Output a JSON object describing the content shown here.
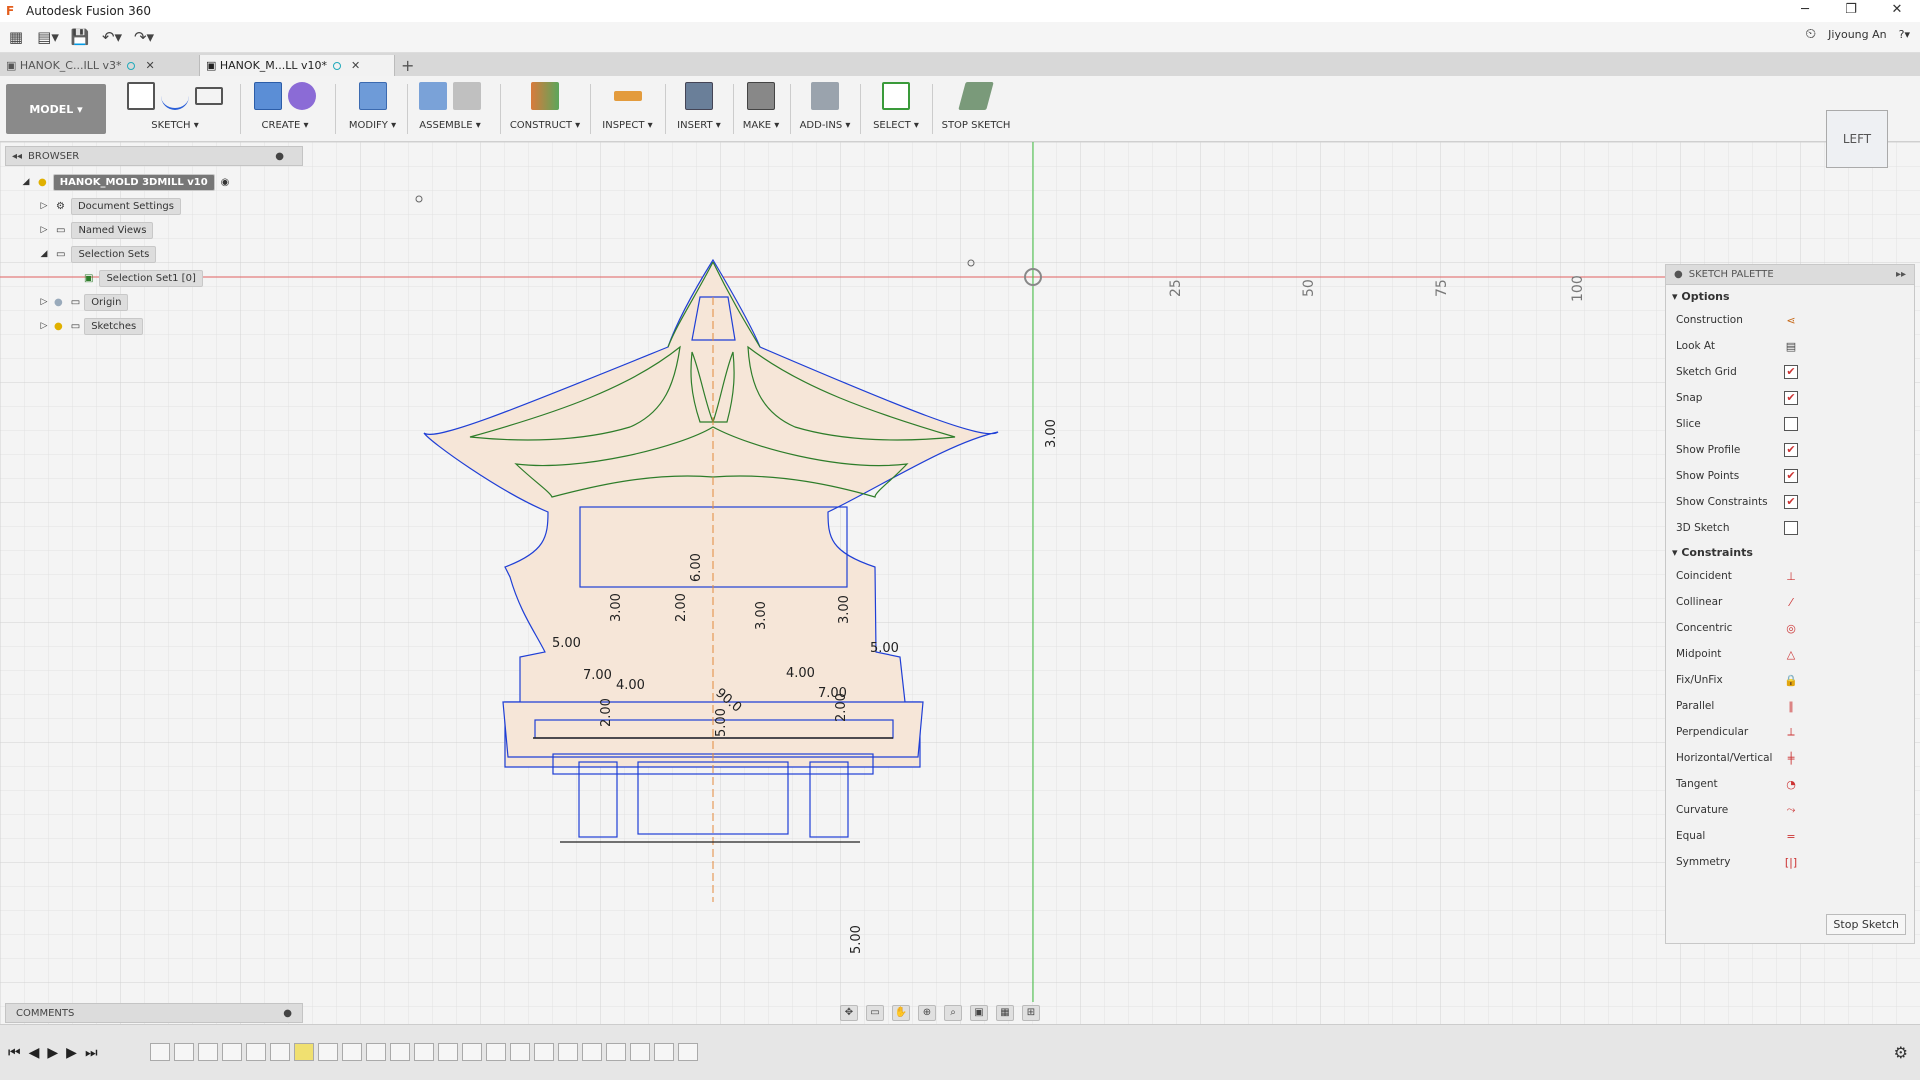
{
  "app": {
    "title": "Autodesk Fusion 360"
  },
  "user": {
    "name": "Jiyoung An"
  },
  "tabs": [
    {
      "label": "HANOK_C...ILL v3*",
      "active": false
    },
    {
      "label": "HANOK_M...LL v10*",
      "active": true
    }
  ],
  "toolbar": {
    "workspace": "MODEL",
    "groups": [
      "SKETCH",
      "CREATE",
      "MODIFY",
      "ASSEMBLE",
      "CONSTRUCT",
      "INSPECT",
      "INSERT",
      "MAKE",
      "ADD-INS",
      "SELECT",
      "STOP SKETCH"
    ]
  },
  "browser": {
    "title": "BROWSER",
    "root": "HANOK_MOLD 3DMILL v10",
    "items": [
      "Document Settings",
      "Named Views",
      "Selection Sets",
      "Selection Set1 [0]",
      "Origin",
      "Sketches"
    ]
  },
  "palette": {
    "title": "SKETCH PALETTE",
    "options_title": "Options",
    "options": [
      {
        "label": "Construction",
        "checked": null,
        "icon": "construction-icon"
      },
      {
        "label": "Look At",
        "checked": null,
        "icon": "look-at-icon"
      },
      {
        "label": "Sketch Grid",
        "checked": true
      },
      {
        "label": "Snap",
        "checked": true
      },
      {
        "label": "Slice",
        "checked": false
      },
      {
        "label": "Show Profile",
        "checked": true
      },
      {
        "label": "Show Points",
        "checked": true
      },
      {
        "label": "Show Constraints",
        "checked": true
      },
      {
        "label": "3D Sketch",
        "checked": false
      }
    ],
    "constraints_title": "Constraints",
    "constraints": [
      "Coincident",
      "Collinear",
      "Concentric",
      "Midpoint",
      "Fix/UnFix",
      "Parallel",
      "Perpendicular",
      "Horizontal/Vertical",
      "Tangent",
      "Curvature",
      "Equal",
      "Symmetry"
    ],
    "stop_button": "Stop Sketch"
  },
  "comments": {
    "label": "COMMENTS"
  },
  "viewcube": {
    "label": "LEFT"
  },
  "axis_labels": [
    "25",
    "50",
    "75",
    "100"
  ],
  "dimensions": [
    "3.00",
    "6.00",
    "2.00",
    "3.00",
    "3.00",
    "3.00",
    "5.00",
    "5.00",
    "7.00",
    "4.00",
    "4.00",
    "7.00",
    "2.00",
    "2.00",
    "90.0",
    "5.00",
    "5.00"
  ],
  "colors": {
    "profile_fill": "#f6e6d8",
    "sketch_blue": "#1f3fd6",
    "sketch_green": "#2e7d2a",
    "axis_red": "#e06060",
    "axis_green": "#3fbf3f"
  }
}
